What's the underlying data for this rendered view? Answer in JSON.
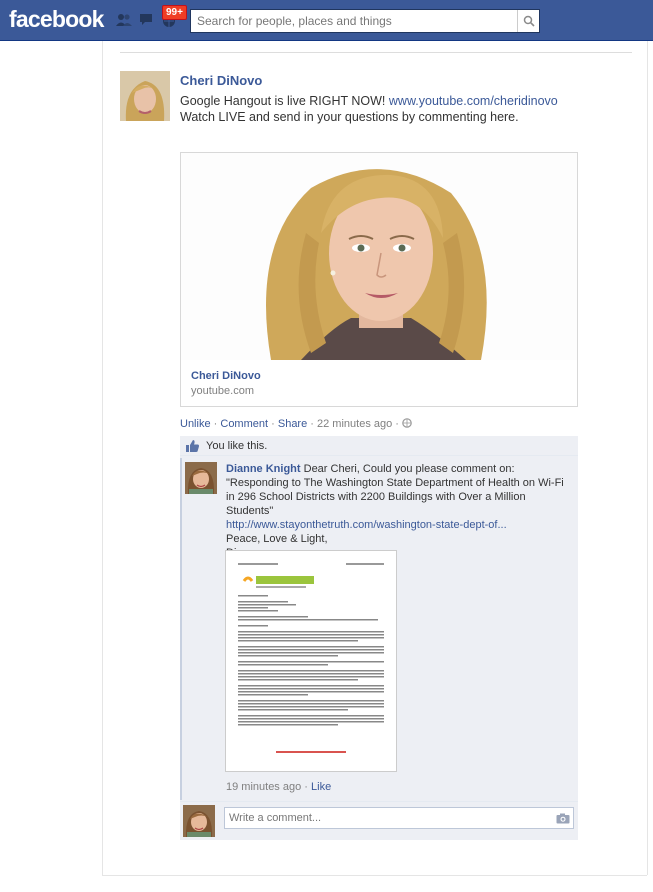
{
  "topbar": {
    "logo": "facebook",
    "notification_count": "99+",
    "search_placeholder": "Search for people, places and things",
    "bg": "#3b5998"
  },
  "post": {
    "author": "Cheri DiNovo",
    "message_text": "Google Hangout is live RIGHT NOW!",
    "message_link": "www.youtube.com/cheridinovo",
    "message_text2": "Watch LIVE and send in your questions by commenting here.",
    "share": {
      "title": "Cheri DiNovo",
      "source": "youtube.com"
    },
    "actions": {
      "unlike": "Unlike",
      "comment": "Comment",
      "share": "Share",
      "time": "22 minutes ago",
      "audience_icon": "globe-icon"
    },
    "likes": {
      "text": "You like this."
    }
  },
  "comment": {
    "author": "Dianne Knight",
    "text1": "Dear Cheri, Could you please comment on: \"Responding to The Washington State Department of Health on Wi-Fi in 296 School Districts with 2200 Buildings with Over a Million Students\"",
    "link": "http://www.stayonthetruth.com/washington-state-dept-of...",
    "text2": "Peace, Love & Light,",
    "text3": "Dianne",
    "time": "19 minutes ago",
    "like": "Like"
  },
  "composer": {
    "placeholder": "Write a comment..."
  }
}
